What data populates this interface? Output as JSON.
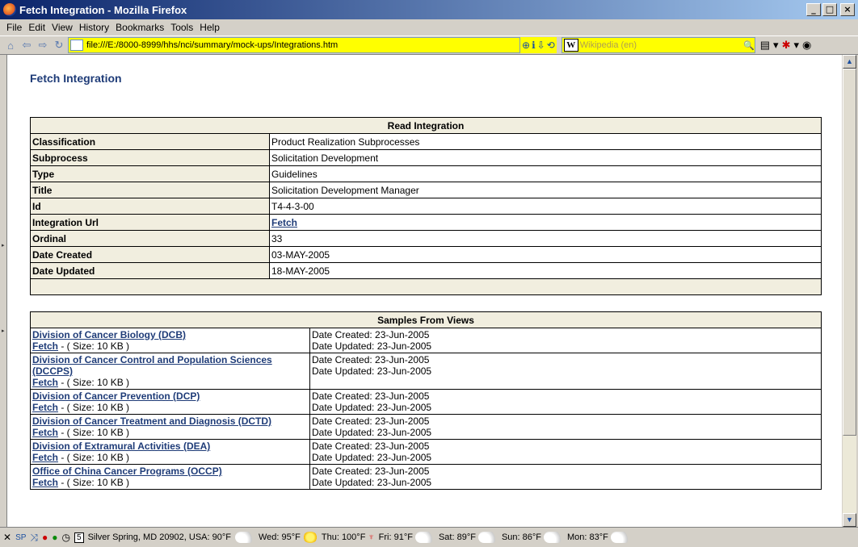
{
  "window": {
    "title": "Fetch Integration - Mozilla Firefox",
    "min": "_",
    "max": "□",
    "close": "×"
  },
  "menu": [
    "File",
    "Edit",
    "View",
    "History",
    "Bookmarks",
    "Tools",
    "Help"
  ],
  "nav": {
    "url": "file:///E:/8000-8999/hhs/nci/summary/mock-ups/Integrations.htm",
    "wiki_placeholder": "Wikipedia (en)"
  },
  "page": {
    "title": "Fetch Integration",
    "read": {
      "header": "Read Integration",
      "rows": [
        {
          "k": "Classification",
          "v": "Product Realization Subprocesses"
        },
        {
          "k": "Subprocess",
          "v": "Solicitation Development"
        },
        {
          "k": "Type",
          "v": "Guidelines"
        },
        {
          "k": "Title",
          "v": "Solicitation Development Manager"
        },
        {
          "k": "Id",
          "v": "T4-4-3-00"
        },
        {
          "k": "Integration Url",
          "v": "Fetch"
        },
        {
          "k": "Ordinal",
          "v": "33"
        },
        {
          "k": "Date Created",
          "v": "03-MAY-2005"
        },
        {
          "k": "Date Updated",
          "v": "18-MAY-2005"
        }
      ]
    },
    "samples": {
      "header": "Samples From Views",
      "fetch": "Fetch",
      "size": " - ( Size: 10 KB )",
      "created": "Date Created: 23-Jun-2005",
      "updated": "Date Updated: 23-Jun-2005",
      "rows": [
        {
          "name": "Division of Cancer Biology (DCB)"
        },
        {
          "name": "Division of Cancer Control and Population Sciences (DCCPS)"
        },
        {
          "name": "Division of Cancer Prevention (DCP)"
        },
        {
          "name": "Division of Cancer Treatment and Diagnosis (DCTD)"
        },
        {
          "name": "Division of Extramural Activities (DEA)"
        },
        {
          "name": "Office of China Cancer Programs (OCCP)"
        }
      ]
    }
  },
  "status": {
    "location": "Silver Spring, MD 20902, USA: 90°F",
    "calendar_day": "5",
    "forecast": [
      {
        "day": "Wed: 95°F",
        "icon": "partly-cloudy-icon"
      },
      {
        "day": "Thu: 100°F",
        "icon": "sun-icon"
      },
      {
        "day": "Fri: 91°F",
        "icon": "partly-cloudy-icon"
      },
      {
        "day": "Sat: 89°F",
        "icon": "partly-cloudy-icon"
      },
      {
        "day": "Sun: 86°F",
        "icon": "partly-cloudy-icon"
      },
      {
        "day": "Mon: 83°F",
        "icon": "partly-cloudy-icon"
      }
    ]
  }
}
